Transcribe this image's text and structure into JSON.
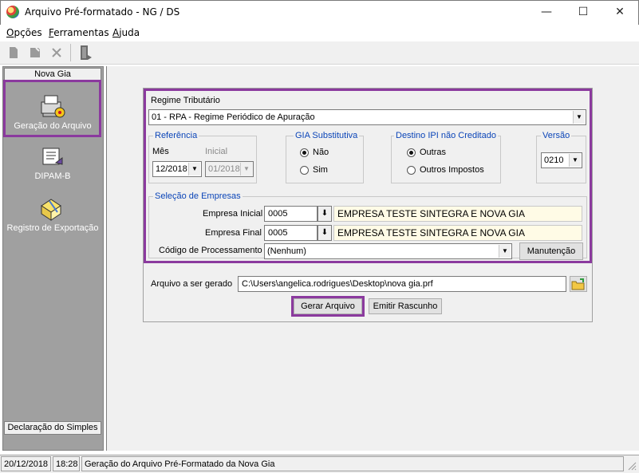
{
  "window": {
    "title": "Arquivo Pré-formatado - NG / DS",
    "minimize": "—",
    "maximize": "☐",
    "close": "✕"
  },
  "menu": {
    "opcoes": "O",
    "opcoes_rest": "pções",
    "ferramentas": "F",
    "ferramentas_rest": "erramentas",
    "ajuda": "A",
    "ajuda_rest": "juda"
  },
  "toolbar": [
    "new-icon",
    "save-icon",
    "delete-icon",
    "exit-icon"
  ],
  "sidebar": {
    "header": "Nova Gia",
    "items": [
      {
        "label": "Geração do Arquivo",
        "icon": "file-generation-icon"
      },
      {
        "label": "DIPAM-B",
        "icon": "dipam-icon"
      },
      {
        "label": "Registro de Exportação",
        "icon": "export-registry-icon"
      }
    ],
    "footer": "Declaração do Simples"
  },
  "form": {
    "regime_label": "Regime Tributário",
    "regime_value": "01 - RPA - Regime Periódico de Apuração",
    "referencia": {
      "title": "Referência",
      "mes_label": "Mês",
      "mes_value": "12/2018",
      "inicial_label": "Inicial",
      "inicial_value": "01/2018"
    },
    "gia_substitutiva": {
      "title": "GIA Substitutiva",
      "opt_nao": "Não",
      "opt_sim": "Sim",
      "selected": "Não"
    },
    "destino_ipi": {
      "title": "Destino IPI não Creditado",
      "opt_outras": "Outras",
      "opt_outros_impostos": "Outros Impostos",
      "selected": "Outras"
    },
    "versao": {
      "title": "Versão",
      "value": "0210"
    },
    "selecao": {
      "title": "Seleção de Empresas",
      "empresa_inicial_label": "Empresa Inicial",
      "empresa_inicial_code": "0005",
      "empresa_inicial_name": "EMPRESA TESTE SINTEGRA E NOVA GIA",
      "empresa_final_label": "Empresa Final",
      "empresa_final_code": "0005",
      "empresa_final_name": "EMPRESA TESTE SINTEGRA E NOVA GIA",
      "codigo_label": "Código de Processamento",
      "codigo_value": "(Nenhum)",
      "manutencao_button": "Manutenção"
    },
    "arquivo_label": "Arquivo a ser gerado",
    "arquivo_value": "C:\\Users\\angelica.rodrigues\\Desktop\\nova gia.prf",
    "gerar_button": "Gerar Arquivo",
    "emitir_button": "Emitir Rascunho"
  },
  "status": {
    "date": "20/12/2018",
    "time": "18:28",
    "message": "Geração do Arquivo Pré-Formatado da Nova Gia"
  },
  "colors": {
    "highlight": "#8b3a9e",
    "group_title": "#0b45b8",
    "sidebar_bg": "#a0a0a0"
  }
}
